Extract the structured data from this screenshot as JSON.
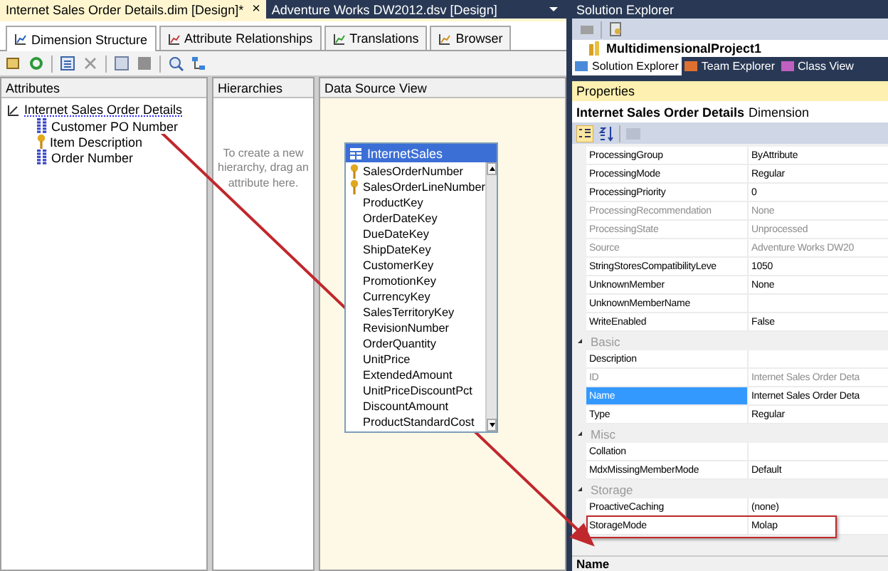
{
  "document_tabs": [
    {
      "label": "Internet Sales Order Details.dim [Design]*",
      "selected": true,
      "close": "×"
    },
    {
      "label": "Adventure Works DW2012.dsv [Design]",
      "selected": false
    }
  ],
  "designer_tabs": [
    {
      "label": "Dimension Structure",
      "selected": true
    },
    {
      "label": "Attribute Relationships",
      "selected": false
    },
    {
      "label": "Translations",
      "selected": false
    },
    {
      "label": "Browser",
      "selected": false
    }
  ],
  "attributes": {
    "title": "Attributes",
    "dimension": "Internet Sales Order Details",
    "children": [
      {
        "label": "Customer PO Number",
        "key": false
      },
      {
        "label": "Item Description",
        "key": true
      },
      {
        "label": "Order Number",
        "key": false
      }
    ]
  },
  "hierarchies": {
    "title": "Hierarchies",
    "hint": "To create a new hierarchy, drag an attribute here."
  },
  "data_source_view": {
    "title": "Data Source View",
    "table": {
      "name": "InternetSales",
      "columns": [
        {
          "name": "SalesOrderNumber",
          "key": true
        },
        {
          "name": "SalesOrderLineNumber",
          "key": true
        },
        {
          "name": "ProductKey",
          "key": false
        },
        {
          "name": "OrderDateKey",
          "key": false
        },
        {
          "name": "DueDateKey",
          "key": false
        },
        {
          "name": "ShipDateKey",
          "key": false
        },
        {
          "name": "CustomerKey",
          "key": false
        },
        {
          "name": "PromotionKey",
          "key": false
        },
        {
          "name": "CurrencyKey",
          "key": false
        },
        {
          "name": "SalesTerritoryKey",
          "key": false
        },
        {
          "name": "RevisionNumber",
          "key": false
        },
        {
          "name": "OrderQuantity",
          "key": false
        },
        {
          "name": "UnitPrice",
          "key": false
        },
        {
          "name": "ExtendedAmount",
          "key": false
        },
        {
          "name": "UnitPriceDiscountPct",
          "key": false
        },
        {
          "name": "DiscountAmount",
          "key": false
        },
        {
          "name": "ProductStandardCost",
          "key": false
        }
      ]
    }
  },
  "solution_explorer": {
    "title": "Solution Explorer",
    "project": "MultidimensionalProject1",
    "tabs": [
      {
        "label": "Solution Explorer",
        "selected": true
      },
      {
        "label": "Team Explorer",
        "selected": false
      },
      {
        "label": "Class View",
        "selected": false
      }
    ]
  },
  "properties": {
    "title": "Properties",
    "object_name": "Internet Sales Order Details",
    "object_type": "Dimension",
    "rows": [
      {
        "kind": "property",
        "name": "ProcessingGroup",
        "value": "ByAttribute",
        "disabled": false,
        "selected": false,
        "highlighted": false
      },
      {
        "kind": "property",
        "name": "ProcessingMode",
        "value": "Regular",
        "disabled": false,
        "selected": false,
        "highlighted": false
      },
      {
        "kind": "property",
        "name": "ProcessingPriority",
        "value": "0",
        "disabled": false,
        "selected": false,
        "highlighted": false
      },
      {
        "kind": "property",
        "name": "ProcessingRecommendation",
        "value": "None",
        "disabled": true,
        "selected": false,
        "highlighted": false
      },
      {
        "kind": "property",
        "name": "ProcessingState",
        "value": "Unprocessed",
        "disabled": true,
        "selected": false,
        "highlighted": false
      },
      {
        "kind": "property",
        "name": "Source",
        "value": "Adventure Works DW20",
        "disabled": true,
        "selected": false,
        "highlighted": false
      },
      {
        "kind": "property",
        "name": "StringStoresCompatibilityLeve",
        "value": "1050",
        "disabled": false,
        "selected": false,
        "highlighted": false
      },
      {
        "kind": "property",
        "name": "UnknownMember",
        "value": "None",
        "disabled": false,
        "selected": false,
        "highlighted": false
      },
      {
        "kind": "property",
        "name": "UnknownMemberName",
        "disabled": false,
        "selected": false,
        "highlighted": false
      },
      {
        "kind": "property",
        "name": "WriteEnabled",
        "value": "False",
        "disabled": false,
        "selected": false,
        "highlighted": false
      },
      {
        "kind": "category",
        "name": "Basic",
        "expanded": true
      },
      {
        "kind": "property",
        "name": "Description",
        "disabled": false,
        "selected": false,
        "highlighted": false
      },
      {
        "kind": "property",
        "name": "ID",
        "value": "Internet Sales Order Deta",
        "disabled": true,
        "selected": false,
        "highlighted": false
      },
      {
        "kind": "property",
        "name": "Name",
        "value": "Internet Sales Order Deta",
        "disabled": false,
        "selected": true,
        "highlighted": false
      },
      {
        "kind": "property",
        "name": "Type",
        "value": "Regular",
        "disabled": false,
        "selected": false,
        "highlighted": false
      },
      {
        "kind": "category",
        "name": "Misc",
        "expanded": true
      },
      {
        "kind": "property",
        "name": "Collation",
        "disabled": false,
        "selected": false,
        "highlighted": false
      },
      {
        "kind": "property",
        "name": "MdxMissingMemberMode",
        "value": "Default",
        "disabled": false,
        "selected": false,
        "highlighted": false
      },
      {
        "kind": "category",
        "name": "Storage",
        "expanded": true
      },
      {
        "kind": "property",
        "name": "ProactiveCaching",
        "value": "(none)",
        "disabled": false,
        "selected": false,
        "highlighted": false
      },
      {
        "kind": "property",
        "name": "StorageMode",
        "value": "Molap",
        "disabled": false,
        "selected": false,
        "highlighted": true
      }
    ],
    "description_title": "Name"
  }
}
